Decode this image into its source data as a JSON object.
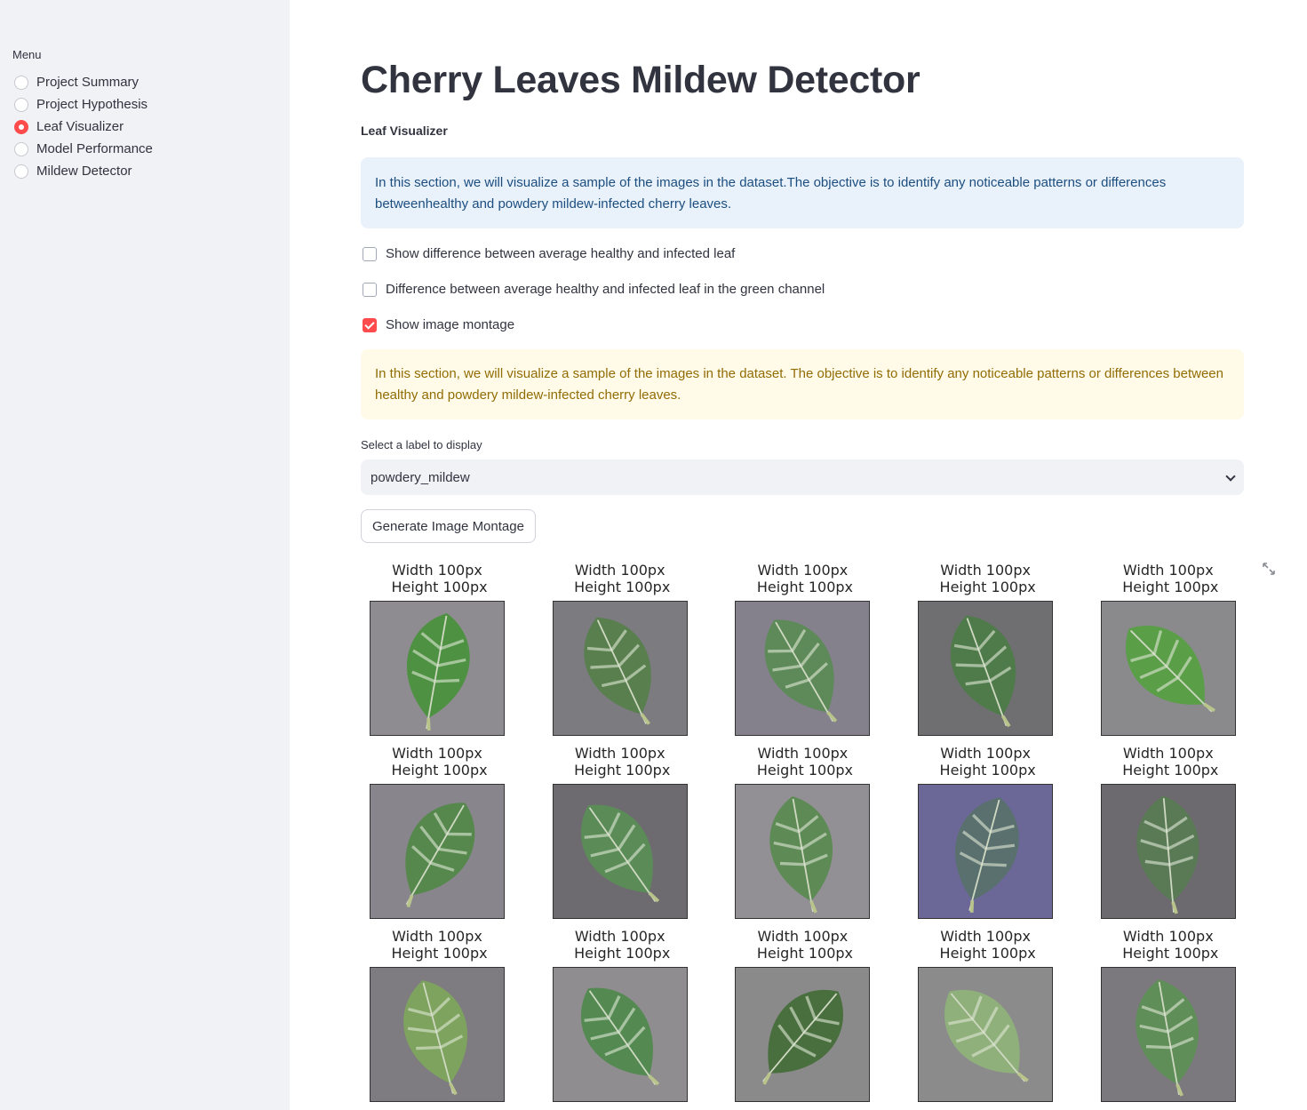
{
  "sidebar": {
    "menu_label": "Menu",
    "items": [
      {
        "label": "Project Summary",
        "selected": false
      },
      {
        "label": "Project Hypothesis",
        "selected": false
      },
      {
        "label": "Leaf Visualizer",
        "selected": true
      },
      {
        "label": "Model Performance",
        "selected": false
      },
      {
        "label": "Mildew Detector",
        "selected": false
      }
    ]
  },
  "main": {
    "title": "Cherry Leaves Mildew Detector",
    "subtitle": "Leaf Visualizer",
    "info_text": "In this section, we will visualize a sample of the images in the dataset.The objective is to identify any noticeable patterns or differences betweenhealthy and powdery mildew-infected cherry leaves.",
    "checkboxes": [
      {
        "label": "Show difference between average healthy and infected leaf",
        "checked": false
      },
      {
        "label": "Difference between average healthy and infected leaf in the green channel",
        "checked": false
      },
      {
        "label": "Show image montage",
        "checked": true
      }
    ],
    "warning_text": "In this section, we will visualize a sample of the images in the dataset. The objective is to identify any noticeable patterns or differences between healthy and powdery mildew-infected cherry leaves.",
    "select": {
      "label": "Select a label to display",
      "value": "powdery_mildew"
    },
    "button_label": "Generate Image Montage",
    "expand_icon": "expand-icon"
  },
  "montage": {
    "caption": "Width 100px\n Height 100px",
    "rows": 3,
    "cols": 5,
    "colors": {
      "leaf_green": "#4f8a45",
      "mildew_white": "#dfe8d6",
      "background_gray": "#8f8f93",
      "background_purple": "#7d78a8"
    }
  }
}
